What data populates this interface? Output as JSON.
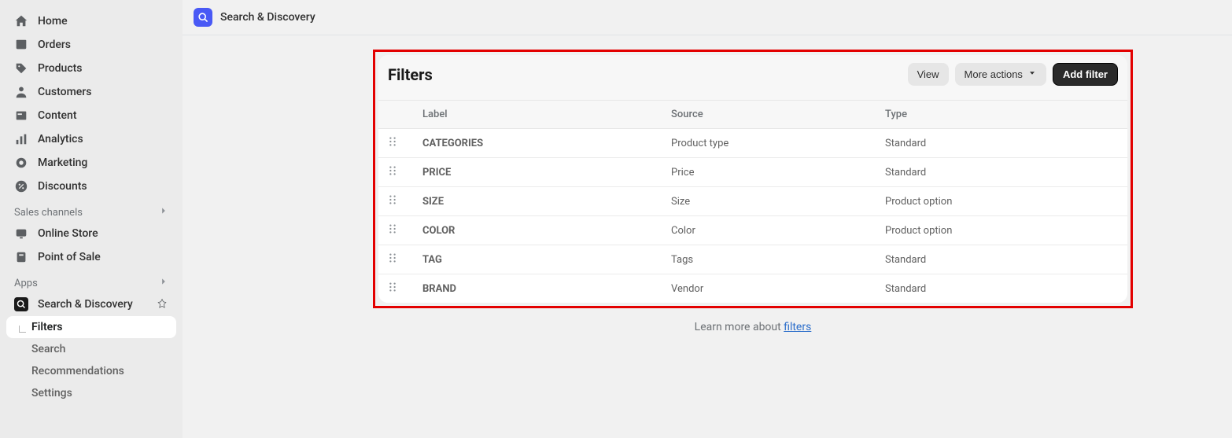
{
  "sidebar": {
    "nav": [
      {
        "label": "Home"
      },
      {
        "label": "Orders"
      },
      {
        "label": "Products"
      },
      {
        "label": "Customers"
      },
      {
        "label": "Content"
      },
      {
        "label": "Analytics"
      },
      {
        "label": "Marketing"
      },
      {
        "label": "Discounts"
      }
    ],
    "sales_channels_heading": "Sales channels",
    "sales_channels": [
      {
        "label": "Online Store"
      },
      {
        "label": "Point of Sale"
      }
    ],
    "apps_heading": "Apps",
    "app_name": "Search & Discovery",
    "app_subitems": [
      {
        "label": "Filters",
        "active": true
      },
      {
        "label": "Search"
      },
      {
        "label": "Recommendations"
      },
      {
        "label": "Settings"
      }
    ]
  },
  "header": {
    "title": "Search & Discovery"
  },
  "filters_card": {
    "title": "Filters",
    "view_btn": "View",
    "more_actions_btn": "More actions",
    "add_filter_btn": "Add filter",
    "columns": {
      "label": "Label",
      "source": "Source",
      "type": "Type"
    },
    "rows": [
      {
        "label": "CATEGORIES",
        "source": "Product type",
        "type": "Standard"
      },
      {
        "label": "PRICE",
        "source": "Price",
        "type": "Standard"
      },
      {
        "label": "SIZE",
        "source": "Size",
        "type": "Product option"
      },
      {
        "label": "COLOR",
        "source": "Color",
        "type": "Product option"
      },
      {
        "label": "TAG",
        "source": "Tags",
        "type": "Standard"
      },
      {
        "label": "BRAND",
        "source": "Vendor",
        "type": "Standard"
      }
    ]
  },
  "footer": {
    "learn_text": "Learn more about ",
    "learn_link": "filters"
  }
}
